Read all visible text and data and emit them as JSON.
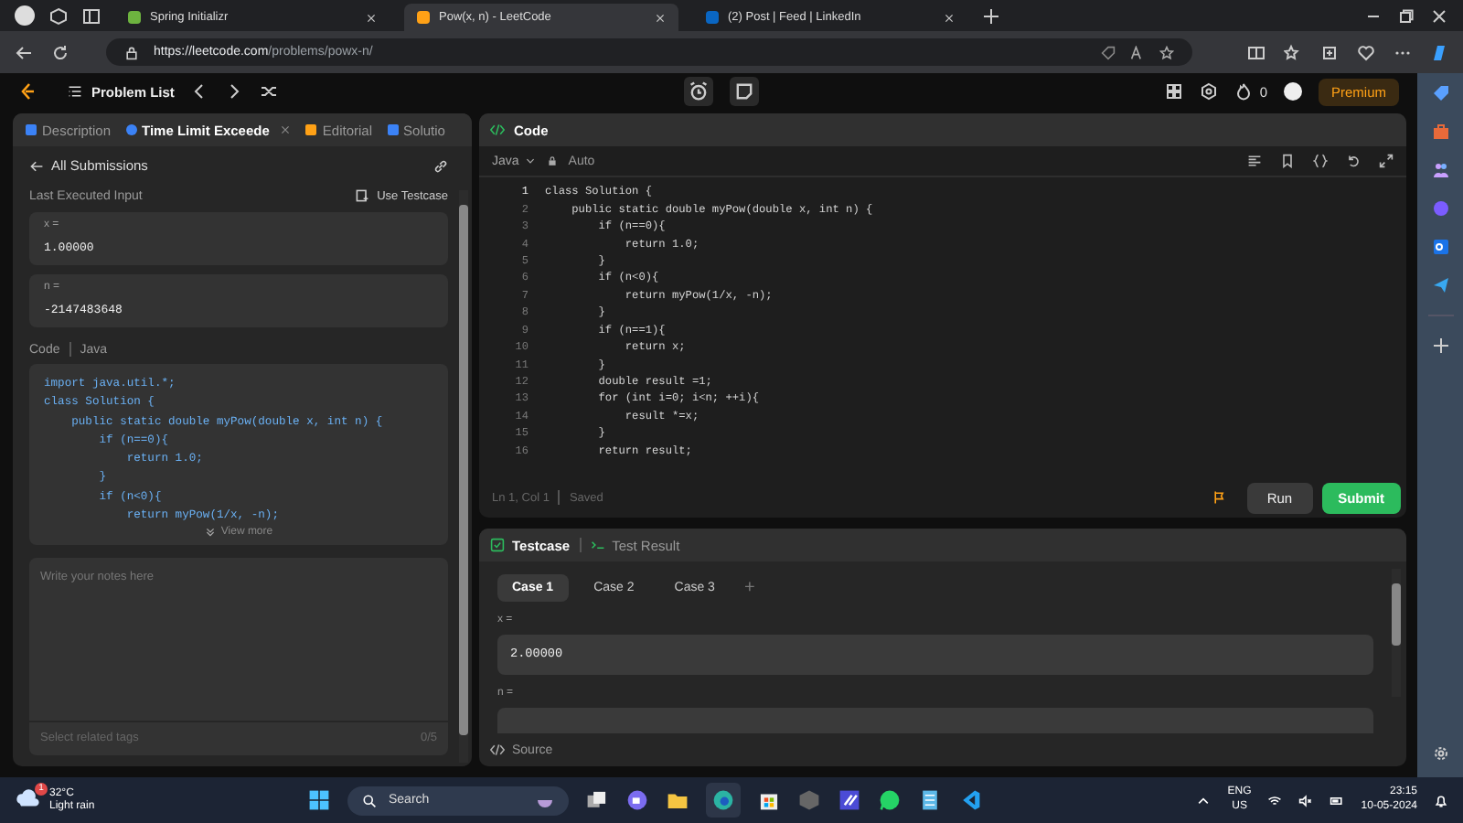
{
  "browser": {
    "tabs": [
      {
        "title": "Spring Initializr",
        "selected": false
      },
      {
        "title": "Pow(x, n) - LeetCode",
        "selected": true
      },
      {
        "title": "(2) Post | Feed | LinkedIn",
        "selected": false
      }
    ],
    "url_host": "https://leetcode.com",
    "url_path": "/problems/powx-n/"
  },
  "nav": {
    "title": "Problem List",
    "streak": "0",
    "premium": "Premium"
  },
  "left_panel": {
    "tabs": [
      {
        "label": "Description",
        "selected": false
      },
      {
        "label": "Time Limit Exceede",
        "selected": true
      },
      {
        "label": "Editorial",
        "selected": false
      },
      {
        "label": "Solutio",
        "selected": false
      }
    ],
    "back_link": "All Submissions",
    "section_title": "Last Executed Input",
    "use_testcase": "Use Testcase",
    "inputs": [
      {
        "label": "x =",
        "value": "1.00000"
      },
      {
        "label": "n =",
        "value": "-2147483648"
      }
    ],
    "code_label": "Code",
    "code_language": "Java",
    "code_lines": [
      "import java.util.*;",
      "class Solution {",
      "    public static double myPow(double x, int n) {",
      "        if (n==0){",
      "            return 1.0;",
      "        }",
      "        if (n<0){",
      "            return myPow(1/x, -n);"
    ],
    "view_more": "View more",
    "notes_placeholder": "Write your notes here",
    "tags_placeholder": "Select related tags",
    "tags_count": "0/5"
  },
  "editor": {
    "title": "Code",
    "language": "Java",
    "mode": "Auto",
    "lines": [
      {
        "n": "1",
        "code": "class Solution {"
      },
      {
        "n": "2",
        "code": "    public static double myPow(double x, int n) {"
      },
      {
        "n": "3",
        "code": "        if (n==0){"
      },
      {
        "n": "4",
        "code": "            return 1.0;"
      },
      {
        "n": "5",
        "code": "        }"
      },
      {
        "n": "6",
        "code": "        if (n<0){"
      },
      {
        "n": "7",
        "code": "            return myPow(1/x, -n);"
      },
      {
        "n": "8",
        "code": "        }"
      },
      {
        "n": "9",
        "code": "        if (n==1){"
      },
      {
        "n": "10",
        "code": "            return x;"
      },
      {
        "n": "11",
        "code": "        }"
      },
      {
        "n": "12",
        "code": "        double result =1;"
      },
      {
        "n": "13",
        "code": "        for (int i=0; i<n; ++i){"
      },
      {
        "n": "14",
        "code": "            result *=x;"
      },
      {
        "n": "15",
        "code": "        }"
      },
      {
        "n": "16",
        "code": "        return result;"
      }
    ],
    "cursor": "Ln 1, Col 1",
    "save_state": "Saved",
    "run": "Run",
    "submit": "Submit"
  },
  "testcase": {
    "tabs": [
      {
        "label": "Testcase",
        "selected": true
      },
      {
        "label": "Test Result",
        "selected": false
      }
    ],
    "cases": [
      {
        "label": "Case 1",
        "selected": true
      },
      {
        "label": "Case 2",
        "selected": false
      },
      {
        "label": "Case 3",
        "selected": false
      }
    ],
    "add": "+",
    "inputs": [
      {
        "label": "x =",
        "value": "2.00000"
      },
      {
        "label": "n ="
      }
    ],
    "source": "Source"
  },
  "taskbar": {
    "weather_temp": "32°C",
    "weather_text": "Light rain",
    "weather_alert": "1",
    "search": "Search",
    "lang": "ENG",
    "region": "US",
    "time": "23:15",
    "date": "10-05-2024"
  }
}
